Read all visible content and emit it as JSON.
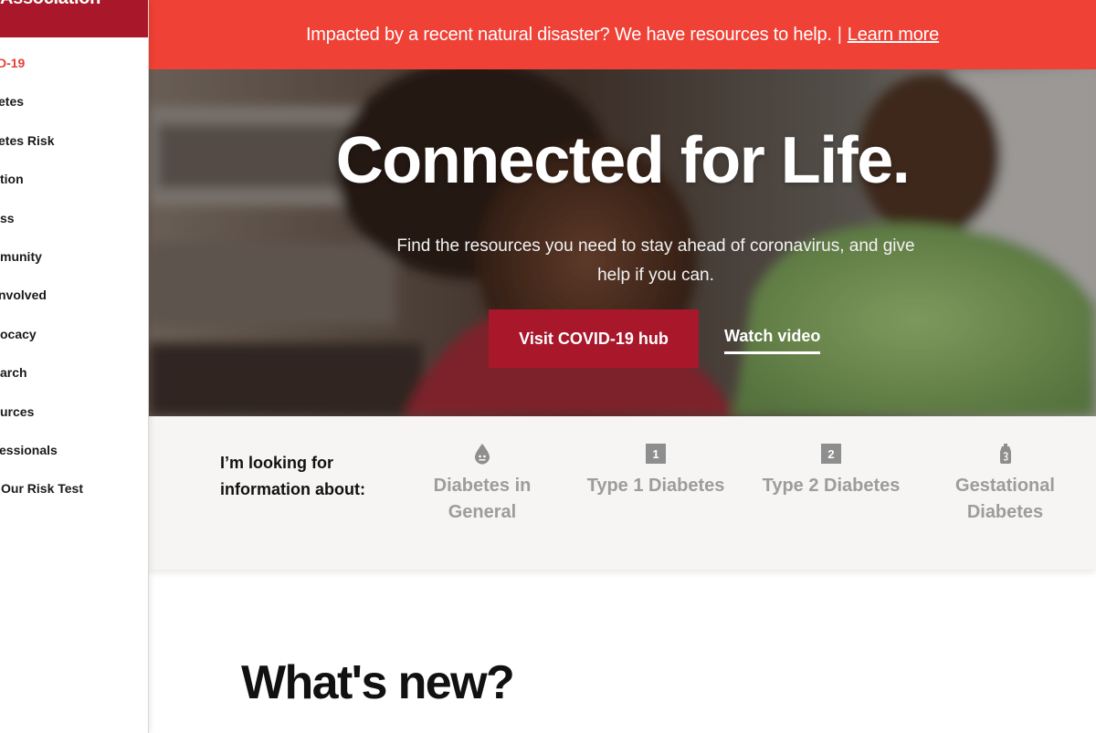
{
  "brand": {
    "name": "Association"
  },
  "sidebar": {
    "items": [
      {
        "label": "D-19",
        "active": true
      },
      {
        "label": "etes"
      },
      {
        "label": "etes Risk"
      },
      {
        "label": "tion"
      },
      {
        "label": "ss"
      },
      {
        "label": "munity"
      },
      {
        "label": "nvolved"
      },
      {
        "label": "ocacy"
      },
      {
        "label": "arch"
      },
      {
        "label": "urces"
      },
      {
        "label": "essionals"
      },
      {
        "label": "Our Risk Test"
      }
    ]
  },
  "alert": {
    "text": "Impacted by a recent natural disaster? We have resources to help.",
    "separator": "|",
    "link": "Learn more"
  },
  "hero": {
    "title": "Connected for Life.",
    "subtitle": "Find the resources you need to stay ahead of coronavirus, and give help if you can.",
    "primary_button": "Visit COVID-19 hub",
    "secondary_link": "Watch video"
  },
  "selector": {
    "label": "I’m looking for information about:",
    "topics": [
      {
        "label": "Diabetes in General",
        "icon": "drop-icon"
      },
      {
        "label": "Type 1 Diabetes",
        "icon": "type-1-icon",
        "badge": "1"
      },
      {
        "label": "Type 2 Diabetes",
        "icon": "type-2-icon",
        "badge": "2"
      },
      {
        "label": "Gestational Diabetes",
        "icon": "gestational-icon"
      }
    ]
  },
  "whats_new": {
    "title": "What's new?"
  },
  "colors": {
    "brand_red": "#a8172a",
    "alert_red": "#ef4136",
    "active_nav": "#e4413a",
    "topic_gray": "#9c9c9c",
    "strip_bg": "#f6f5f3"
  }
}
